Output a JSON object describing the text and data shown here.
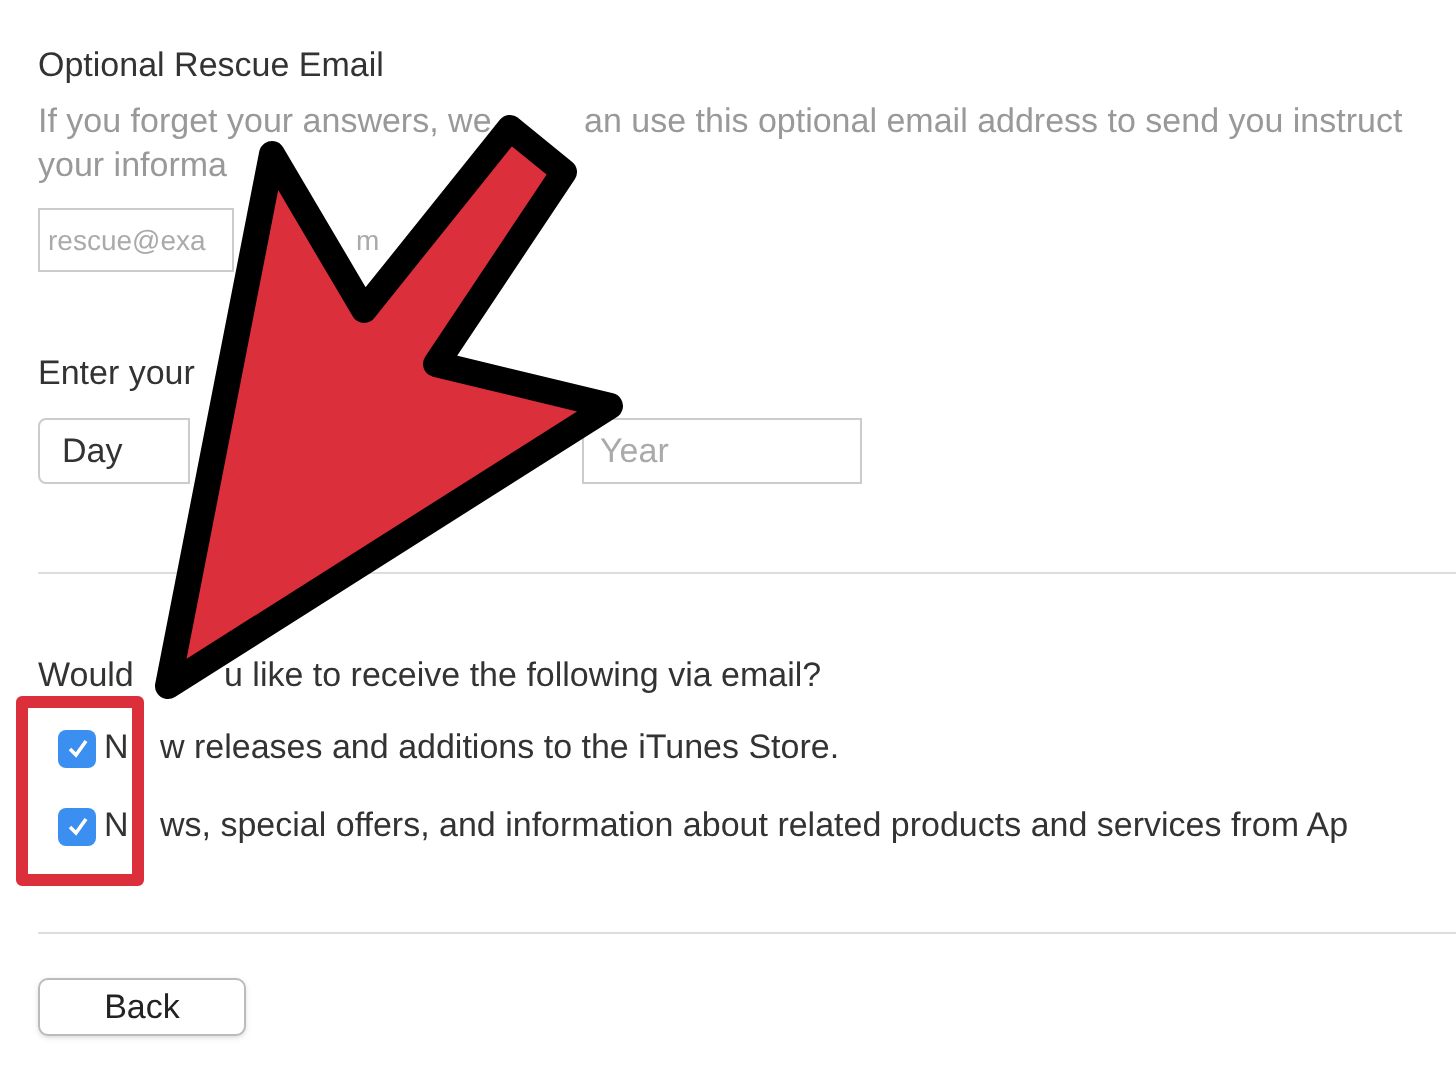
{
  "rescue_email": {
    "title": "Optional Rescue Email",
    "description": [
      "If you forget your answers, we",
      "an use this optional email address to send you instruct"
    ],
    "description_line_2": "your informa",
    "placeholder": "rescue@exa",
    "placeholder_fragment": "m"
  },
  "birthday": {
    "label": "Enter your",
    "day": "Day",
    "year_placeholder": "Year"
  },
  "newsletter": {
    "question": [
      "Would",
      "u like to receive the following via email?"
    ],
    "options": [
      {
        "label": [
          "N",
          "w releases and additions to the iTunes Store."
        ],
        "checked": true
      },
      {
        "label": [
          "N",
          "ws, special offers, and information about related products and services from Ap"
        ],
        "checked": true
      }
    ]
  },
  "buttons": [
    "Back"
  ]
}
